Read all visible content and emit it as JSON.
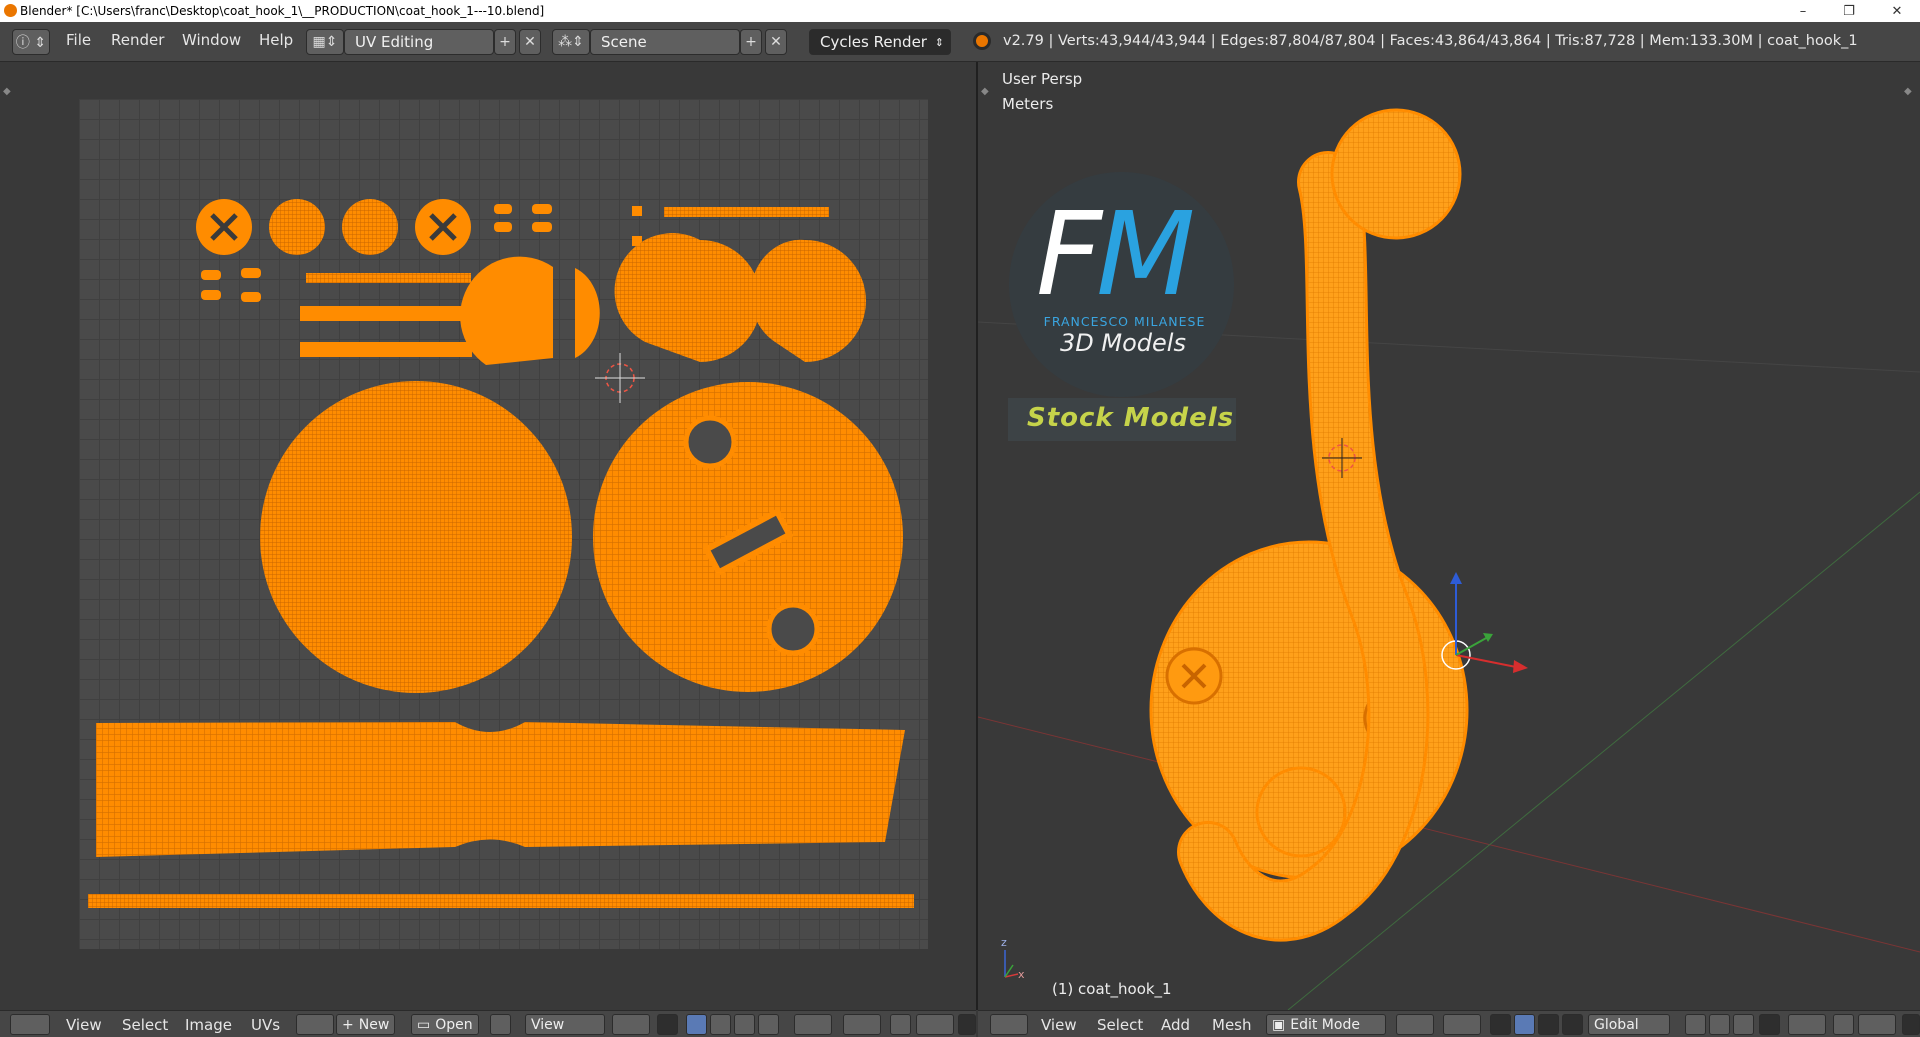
{
  "titlebar": {
    "title": "Blender* [C:\\Users\\franc\\Desktop\\coat_hook_1\\__PRODUCTION\\coat_hook_1---10.blend]",
    "minimize": "–",
    "maximize": "❐",
    "close": "✕"
  },
  "menu": {
    "file": "File",
    "render": "Render",
    "window": "Window",
    "help": "Help"
  },
  "layout": {
    "screen": "UV Editing",
    "scene": "Scene",
    "engine": "Cycles Render"
  },
  "info": {
    "stats": "v2.79 | Verts:43,944/43,944 | Edges:87,804/87,804 | Faces:43,864/43,864 | Tris:87,728 | Mem:133.30M | coat_hook_1"
  },
  "uv_editor": {
    "header": {
      "view": "View",
      "select": "Select",
      "image": "Image",
      "uvs": "UVs",
      "new": "New",
      "open": "Open",
      "view_menu": "View"
    }
  },
  "viewport": {
    "perspective": "User Persp",
    "units": "Meters",
    "object_label": "(1) coat_hook_1",
    "header": {
      "view": "View",
      "select": "Select",
      "add": "Add",
      "mesh": "Mesh",
      "mode": "Edit Mode",
      "orientation": "Global"
    }
  },
  "watermark": {
    "letter_f": "F",
    "letter_m": "M",
    "name": "FRANCESCO MILANESE",
    "tagline": "3D Models",
    "stock": "Stock Models"
  },
  "colors": {
    "mesh_orange": "#ff8c00",
    "accent_blue": "#2aa2e0",
    "stock_yellow": "#c6d34a"
  }
}
